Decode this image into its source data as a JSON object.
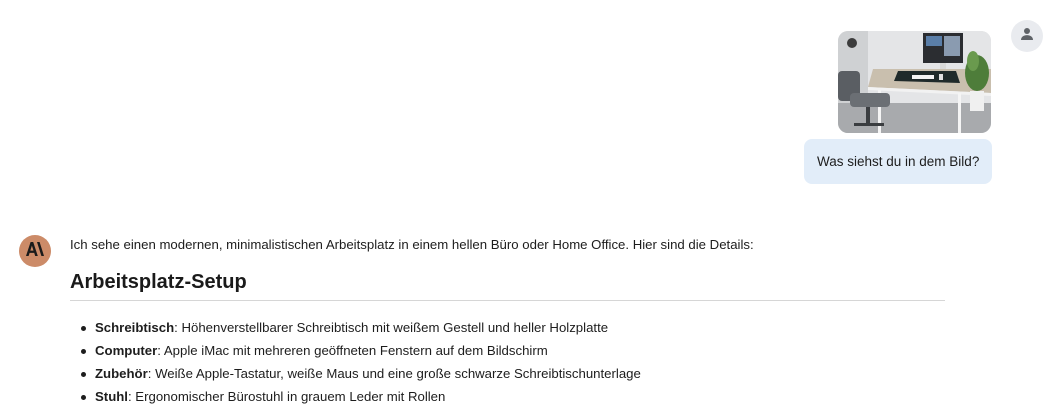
{
  "user_message": {
    "text": "Was siehst du in dem Bild?"
  },
  "assistant_message": {
    "intro": "Ich sehe einen modernen, minimalistischen Arbeitsplatz in einem hellen Büro oder Home Office. Hier sind die Details:",
    "section_heading": "Arbeitsplatz-Setup",
    "items": [
      {
        "label": "Schreibtisch",
        "text": ": Höhenverstellbarer Schreibtisch mit weißem Gestell und heller Holzplatte"
      },
      {
        "label": "Computer",
        "text": ": Apple iMac mit mehreren geöffneten Fenstern auf dem Bildschirm"
      },
      {
        "label": "Zubehör",
        "text": ": Weiße Apple-Tastatur, weiße Maus und eine große schwarze Schreibtischunterlage"
      },
      {
        "label": "Stuhl",
        "text": ": Ergonomischer Bürostuhl in grauem Leder mit Rollen"
      }
    ]
  },
  "icons": {
    "user_avatar": "person-icon",
    "assistant_avatar": "anthropic-logo-icon"
  },
  "colors": {
    "user_bubble_bg": "#e2edf9",
    "assistant_avatar_bg": "#cc8b68",
    "user_avatar_bg": "#e9ebef"
  }
}
